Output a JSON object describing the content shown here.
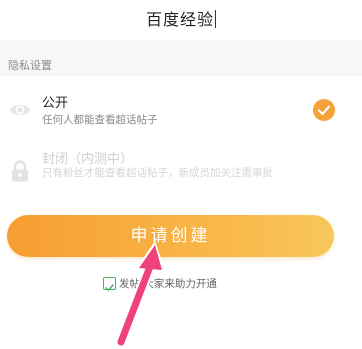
{
  "name_input": {
    "value": "百度经验"
  },
  "privacy": {
    "section_title": "隐私设置",
    "options": [
      {
        "title": "公开",
        "description": "任何人都能查看超话帖子",
        "selected": true,
        "icon": "eye-icon"
      },
      {
        "title": "封闭（内测中）",
        "description": "只有粉丝才能查看超话帖子，新成员加关注需审批",
        "selected": false,
        "icon": "lock-icon"
      }
    ]
  },
  "submit": {
    "label": "申请创建"
  },
  "agreement": {
    "text": "发帖        大家来助力开通",
    "checked": true
  },
  "colors": {
    "accent": "#f5a23b",
    "button_start": "#f79d31",
    "button_end": "#f7c85c",
    "checkbox": "#4caf50",
    "annotation_arrow": "#f0427a"
  },
  "annotation": {
    "icon": "red-arrow-pointer"
  }
}
